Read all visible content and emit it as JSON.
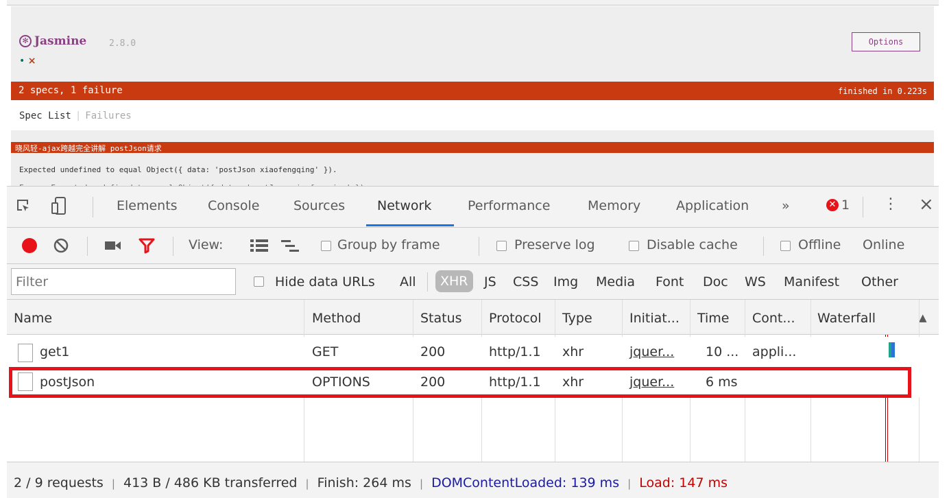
{
  "jasmine": {
    "logo_text": "Jasmine",
    "version": "2.8.0",
    "dots": [
      "•",
      "×"
    ],
    "options_label": "Options",
    "summary": "2 specs, 1 failure",
    "finished": "finished in 0.223s",
    "menu_spec_list": "Spec List",
    "menu_failures": "Failures",
    "failure_title": "晓风轻-ajax跨越完全讲解 postJson请求",
    "failure_message": "Expected undefined to equal Object({ data: 'postJson xiaofengqing' }).",
    "failure_message_2": "Error: Expected undefined to equal Object({ data: 'postJson xiaofengqing' })."
  },
  "devtools": {
    "tabs": [
      "Elements",
      "Console",
      "Sources",
      "Network",
      "Performance",
      "Memory",
      "Application"
    ],
    "active_tab": "Network",
    "more_tabs": "»",
    "error_count": "1",
    "menu_icon": "⋮",
    "close_icon": "×",
    "toolbar": {
      "view_label": "View:",
      "group_by_frame": "Group by frame",
      "preserve_log": "Preserve log",
      "disable_cache": "Disable cache",
      "offline": "Offline",
      "throttle": "Online"
    },
    "filter": {
      "placeholder": "Filter",
      "hide_data_urls": "Hide data URLs",
      "types": [
        "All",
        "XHR",
        "JS",
        "CSS",
        "Img",
        "Media",
        "Font",
        "Doc",
        "WS",
        "Manifest",
        "Other"
      ],
      "selected": "XHR"
    },
    "columns": [
      "Name",
      "Method",
      "Status",
      "Protocol",
      "Type",
      "Initiat...",
      "Time",
      "Cont...",
      "Waterfall"
    ],
    "rows": [
      {
        "name": "get1",
        "method": "GET",
        "status": "200",
        "protocol": "http/1.1",
        "type": "xhr",
        "initiator": "jquer...",
        "time": "10 ...",
        "content": "appli..."
      },
      {
        "name": "postJson",
        "method": "OPTIONS",
        "status": "200",
        "protocol": "http/1.1",
        "type": "xhr",
        "initiator": "jquer...",
        "time": "6 ms",
        "content": ""
      }
    ],
    "status_bar": {
      "requests": "2 / 9 requests",
      "sep": "|",
      "transferred": "413 B / 486 KB transferred",
      "finish": "Finish: 264 ms",
      "dom_content_loaded": "DOMContentLoaded: 139 ms",
      "load": "Load: 147 ms"
    }
  },
  "colors": {
    "jasmine_failure": "#ca3a11",
    "jasmine_purple": "#8a4182",
    "devtools_accent": "#1a73e8",
    "record_red": "#e8121a",
    "highlight_box": "#e8121a",
    "dom_blue": "#1a1aa6",
    "load_red": "#c80000"
  }
}
